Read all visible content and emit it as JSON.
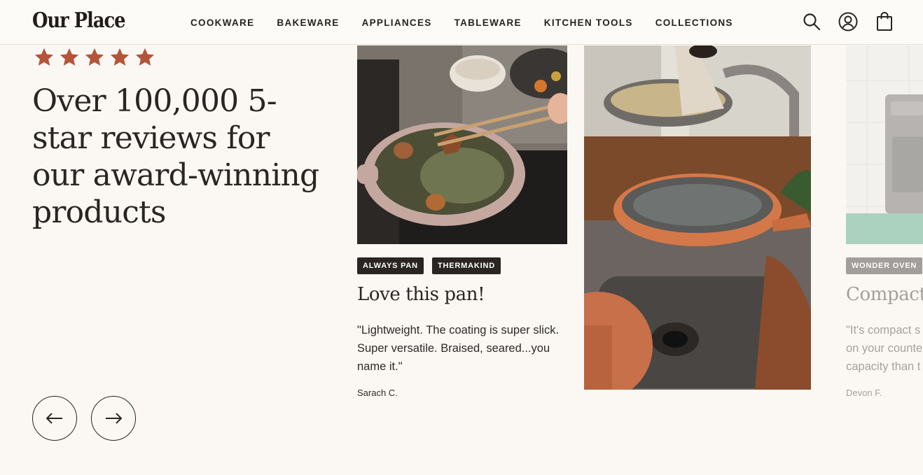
{
  "brand": {
    "logo": "Our Place"
  },
  "nav": {
    "items": [
      "COOKWARE",
      "BAKEWARE",
      "APPLIANCES",
      "TABLEWARE",
      "KITCHEN TOOLS",
      "COLLECTIONS"
    ],
    "icons": [
      "search-icon",
      "account-icon",
      "cart-bag-icon"
    ]
  },
  "hero": {
    "rating": 5,
    "headline": "Over 100,000 5-star reviews for our award-winning products",
    "prev_icon": "arrow-left-icon",
    "next_icon": "arrow-right-icon"
  },
  "colors": {
    "background": "#fbf8f4",
    "star": "#b4543a",
    "tag_bg": "#2a2522",
    "text": "#2a2522"
  },
  "reviews": [
    {
      "tags": [
        "ALWAYS PAN",
        "THERMAKIND"
      ],
      "title": "Love this pan!",
      "quote": "\"Lightweight. The coating is super slick. Super versatile. Braised, seared...you name it.\"",
      "author": "Sarach C."
    },
    {
      "tags": [
        "WONDER OVEN"
      ],
      "title": "Compact",
      "quote_lines": [
        "\"It's compact s",
        "on your counte",
        "capacity than t"
      ],
      "author": "Devon F."
    }
  ]
}
